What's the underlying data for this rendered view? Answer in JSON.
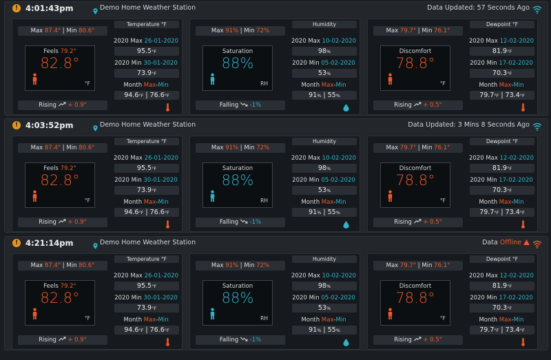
{
  "panels": [
    {
      "time": "4:01:43pm",
      "station": "Demo Home Weather Station",
      "status_prefix": "Data Updated: ",
      "status_value": "57 Seconds Ago",
      "offline": false
    },
    {
      "time": "4:03:52pm",
      "station": "Demo Home Weather Station",
      "status_prefix": "Data Updated: ",
      "status_value": "3 Mins 8 Seconds Ago",
      "offline": false
    },
    {
      "time": "4:21:14pm",
      "station": "Demo Home Weather Station",
      "status_prefix": "Data ",
      "status_value": "Offline",
      "offline": true
    }
  ],
  "cards": {
    "temperature": {
      "max_label": "Max ",
      "max_val": "87.4°",
      "sep": " | Min ",
      "min_val": "80.6°",
      "gauge_label": "Feels ",
      "gauge_label_val": "79.2°",
      "gauge_value": "82.8°",
      "gauge_unit": "°F",
      "trend_word": "Rising ",
      "trend_val": "+ 0.9°",
      "title": "Temperature °F",
      "year_max_label": "2020 Max ",
      "year_max_date": "26-01-2020",
      "year_max_val": "95.5",
      "year_max_unit": "°F",
      "year_min_label": "2020 Min ",
      "year_min_date": "30-01-2020",
      "year_min_val": "73.9",
      "year_min_unit": "°F",
      "month_label": "Month ",
      "month_max": "Max",
      "month_dash": "-",
      "month_min": "Min",
      "month_val1": "94.6",
      "month_u1": "°F",
      "month_sep": " | ",
      "month_val2": "76.6",
      "month_u2": "°F",
      "value_color": "#f05a28"
    },
    "humidity": {
      "max_label": "Max ",
      "max_val": "91%",
      "sep": " | Min ",
      "min_val": "72%",
      "gauge_label": "Saturation",
      "gauge_label_val": "",
      "gauge_value": "88%",
      "gauge_unit": "RH",
      "trend_word": "Falling ",
      "trend_val": "-1%",
      "title": "Humidity",
      "year_max_label": "2020 Max ",
      "year_max_date": "10-02-2020",
      "year_max_val": "98",
      "year_max_unit": "%",
      "year_min_label": "2020 Min ",
      "year_min_date": "05-02-2020",
      "year_min_val": "53",
      "year_min_unit": "%",
      "month_label": "Month ",
      "month_max": "Max",
      "month_dash": "-",
      "month_min": "Min",
      "month_val1": "91",
      "month_u1": "%",
      "month_sep": " | ",
      "month_val2": "55",
      "month_u2": "%",
      "value_color": "#2fb3c9"
    },
    "dewpoint": {
      "max_label": "Max ",
      "max_val": "79.7°",
      "sep": " | Min ",
      "min_val": "76.1°",
      "gauge_label": "Discomfort",
      "gauge_label_val": "",
      "gauge_value": "78.8°",
      "gauge_unit": "°F",
      "trend_word": "Rising ",
      "trend_val": "+ 0.5°",
      "title": "Dewpoint °F",
      "year_max_label": "2020 Max ",
      "year_max_date": "12-02-2020",
      "year_max_val": "81.9",
      "year_max_unit": "°F",
      "year_min_label": "2020 Min ",
      "year_min_date": "17-02-2020",
      "year_min_val": "70.3",
      "year_min_unit": "°F",
      "month_label": "Month ",
      "month_max": "Max",
      "month_dash": "-",
      "month_min": "Min",
      "month_val1": "79.7",
      "month_u1": "°F",
      "month_sep": " | ",
      "month_val2": "73.4",
      "month_u2": "°F",
      "value_color": "#f05a28"
    }
  },
  "colors": {
    "accent_red": "#f05a28",
    "accent_blue": "#2fb3c9",
    "warn": "#e8951a"
  },
  "icons": {
    "warning": "warning-icon",
    "pin": "location-pin-icon",
    "wifi": "wifi-icon",
    "person": "person-icon",
    "trend": "trend-arrow-icon",
    "thermometer": "thermometer-icon",
    "droplet": "droplet-icon"
  }
}
